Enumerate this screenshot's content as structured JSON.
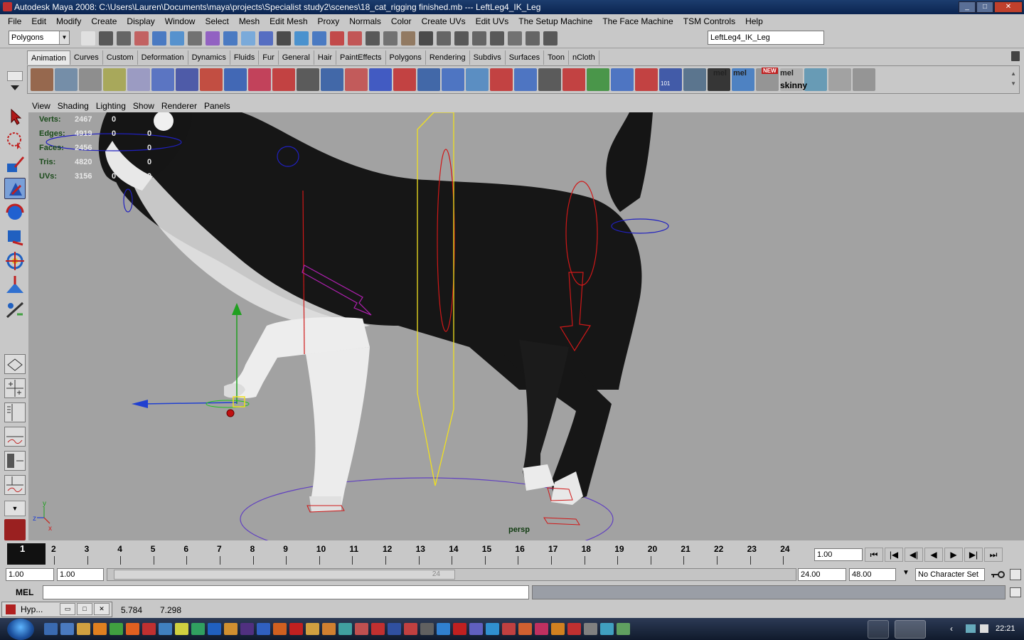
{
  "window": {
    "title": "Autodesk Maya 2008: C:\\Users\\Lauren\\Documents\\maya\\projects\\Specialist study2\\scenes\\18_cat_rigging finished.mb   ---   LeftLeg4_IK_Leg"
  },
  "menubar": [
    "File",
    "Edit",
    "Modify",
    "Create",
    "Display",
    "Window",
    "Select",
    "Mesh",
    "Edit Mesh",
    "Proxy",
    "Normals",
    "Color",
    "Create UVs",
    "Edit UVs",
    "The Setup Machine",
    "The Face Machine",
    "TSM Controls",
    "Help"
  ],
  "statusline": {
    "mode": "Polygons",
    "selected_object": "LeftLeg4_IK_Leg"
  },
  "shelf_tabs": [
    "Animation",
    "Curves",
    "Custom",
    "Deformation",
    "Dynamics",
    "Fluids",
    "Fur",
    "General",
    "Hair",
    "PaintEffects",
    "Polygons",
    "Rendering",
    "Subdivs",
    "Surfaces",
    "Toon",
    "nCloth"
  ],
  "shelf_active": "Animation",
  "shelf_text": {
    "frame_label": "101",
    "mel1": "mel",
    "mel2": "mel",
    "mel3": "mel",
    "new_badge": "NEW",
    "skinny": "skinny"
  },
  "panel_menu": [
    "View",
    "Shading",
    "Lighting",
    "Show",
    "Renderer",
    "Panels"
  ],
  "hud": [
    {
      "label": "Verts:",
      "v1": "2467",
      "v2": "0",
      "v3": ""
    },
    {
      "label": "Edges:",
      "v1": "4919",
      "v2": "0",
      "v3": "0"
    },
    {
      "label": "Faces:",
      "v1": "2456",
      "v2": "0",
      "v3": "0"
    },
    {
      "label": "Tris:",
      "v1": "4820",
      "v2": "0",
      "v3": "0"
    },
    {
      "label": "UVs:",
      "v1": "3156",
      "v2": "0",
      "v3": "0"
    }
  ],
  "camera_label": "persp",
  "axis": {
    "y": "y",
    "z": "z",
    "x": "x"
  },
  "timeline": {
    "current_frame": "1",
    "ticks": [
      "2",
      "3",
      "4",
      "5",
      "6",
      "7",
      "8",
      "9",
      "10",
      "11",
      "12",
      "13",
      "14",
      "15",
      "16",
      "17",
      "18",
      "19",
      "20",
      "21",
      "22",
      "23",
      "24"
    ],
    "current_time": "1.00"
  },
  "range": {
    "start": "1.00",
    "playback_start": "1.00",
    "playback_end": "24.00",
    "end": "48.00",
    "handle_label": "24",
    "character_set": "No Character Set"
  },
  "playback_buttons": [
    "⏮",
    "|◀",
    "◀|",
    "◀",
    "▶",
    "▶|",
    "⏭"
  ],
  "command": {
    "label": "MEL"
  },
  "minimized": {
    "label": "Hyp..."
  },
  "coordinates": {
    "x": "5.784",
    "y": "7.298"
  },
  "taskbar": {
    "time": "22:21"
  },
  "colors": {
    "viewport_bg": "#a2a2a2",
    "ui_bg": "#c8c8c8",
    "titlebar": "#0b2450",
    "ik_handle": "#d01818",
    "selection": "#f0e020"
  }
}
